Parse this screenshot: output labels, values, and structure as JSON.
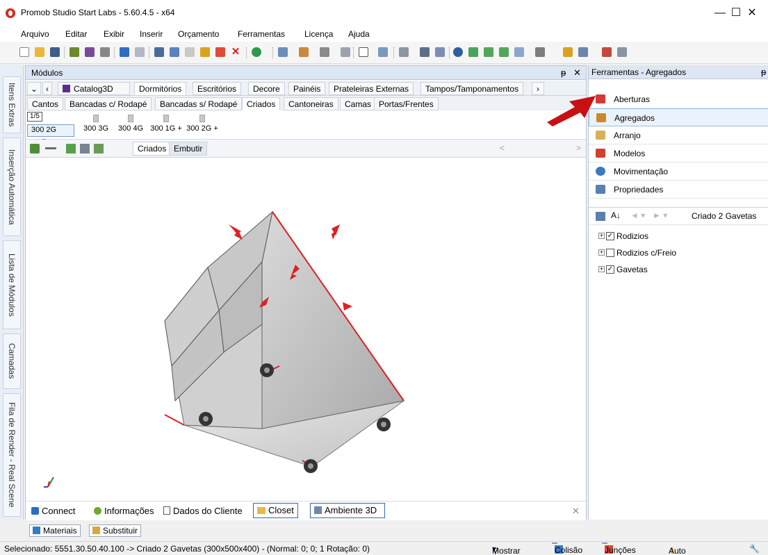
{
  "window": {
    "title": "Promob Studio Start Labs - 5.60.4.5 - x64",
    "minimize": "—",
    "maximize": "☐",
    "close": "✕"
  },
  "menu": [
    "Arquivo",
    "Editar",
    "Exibir",
    "Inserir",
    "Orçamento",
    "Ferramentas",
    "Licença",
    "Ajuda"
  ],
  "left_tabs": [
    "Itens Extras",
    "Inserção Automática",
    "Lista de Módulos",
    "Camadas",
    "Fila de Render - Real Scene"
  ],
  "modules": {
    "title": "Módulos",
    "pin": "ᵽ",
    "close": "✕",
    "catalog_label": "Catalog3D",
    "category_tabs": [
      "Dormitórios",
      "Escritórios",
      "Decore",
      "Painéis",
      "Prateleiras Externas",
      "Tampos/Tamponamentos"
    ],
    "category_active": "Dormitórios",
    "sub_tabs": [
      "Cantos",
      "Bancadas c/ Rodapé",
      "Bancadas s/ Rodapé",
      "Criados",
      "Cantoneiras",
      "Camas",
      "Portas/Frentes"
    ],
    "sub_active": "Criados",
    "page_indicator": "1/5",
    "thumbnails": [
      "300 2G",
      "300 3G",
      "300 4G",
      "300 1G +",
      "300 2G +"
    ],
    "view_tabs": [
      "Criados",
      "Embutir"
    ],
    "nav_left": "<",
    "nav_right": ">"
  },
  "bottom_tabs": [
    "Connect",
    "Informações",
    "Dados do Cliente",
    "Closet",
    "Ambiente 3D"
  ],
  "bottom_close": "✕",
  "lower_tabs": [
    "Materiais",
    "Substituir"
  ],
  "right_pane": {
    "title": "Ferramentas - Agregados",
    "pin": "ᵽ",
    "tools": [
      "Aberturas",
      "Agregados",
      "Arranjo",
      "Modelos",
      "Movimentação",
      "Propriedades"
    ],
    "selected_tool": "Agregados",
    "breadcrumb": "Criado 2 Gavetas",
    "tree": [
      {
        "label": "Rodizios",
        "checked": true
      },
      {
        "label": "Rodizios c/Freio",
        "checked": false
      },
      {
        "label": "Gavetas",
        "checked": true
      }
    ]
  },
  "status": {
    "text": "Selecionado: 5551.30.50.40.100 -> Criado 2 Gavetas (300x500x400) - (Normal: 0; 0; 1 Rotação: 0)",
    "mostrar": "Mostrar",
    "colisao": "Colisão",
    "juncoes": "Junções",
    "auto_rebaixar": "Auto Rebaixar"
  },
  "colors": {
    "accent": "#d42a1d",
    "selection": "#eaf2fb",
    "panel_header": "#dde6f3"
  }
}
